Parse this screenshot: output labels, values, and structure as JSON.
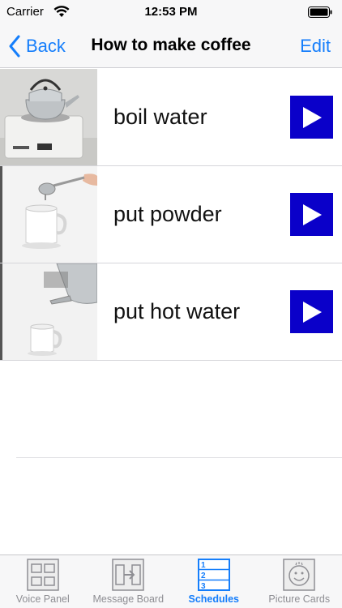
{
  "status_bar": {
    "carrier": "Carrier",
    "time": "12:53 PM"
  },
  "nav": {
    "back_label": "Back",
    "title": "How to make coffee",
    "edit_label": "Edit"
  },
  "steps": [
    {
      "label": "boil water",
      "icon": "kettle-on-stove"
    },
    {
      "label": "put powder",
      "icon": "spoon-over-cup"
    },
    {
      "label": "put hot water",
      "icon": "kettle-pouring-into-cup"
    }
  ],
  "play_button": {
    "color": "#0a00c9",
    "icon": "play-icon"
  },
  "tab_bar": {
    "active_index": 2,
    "tabs": [
      {
        "label": "Voice Panel",
        "icon": "grid-icon"
      },
      {
        "label": "Message Board",
        "icon": "board-arrow-icon"
      },
      {
        "label": "Schedules",
        "icon": "numbered-list-icon"
      },
      {
        "label": "Picture Cards",
        "icon": "smiley-card-icon"
      }
    ]
  },
  "colors": {
    "accent": "#157efb",
    "inactive": "#8e8e93"
  }
}
